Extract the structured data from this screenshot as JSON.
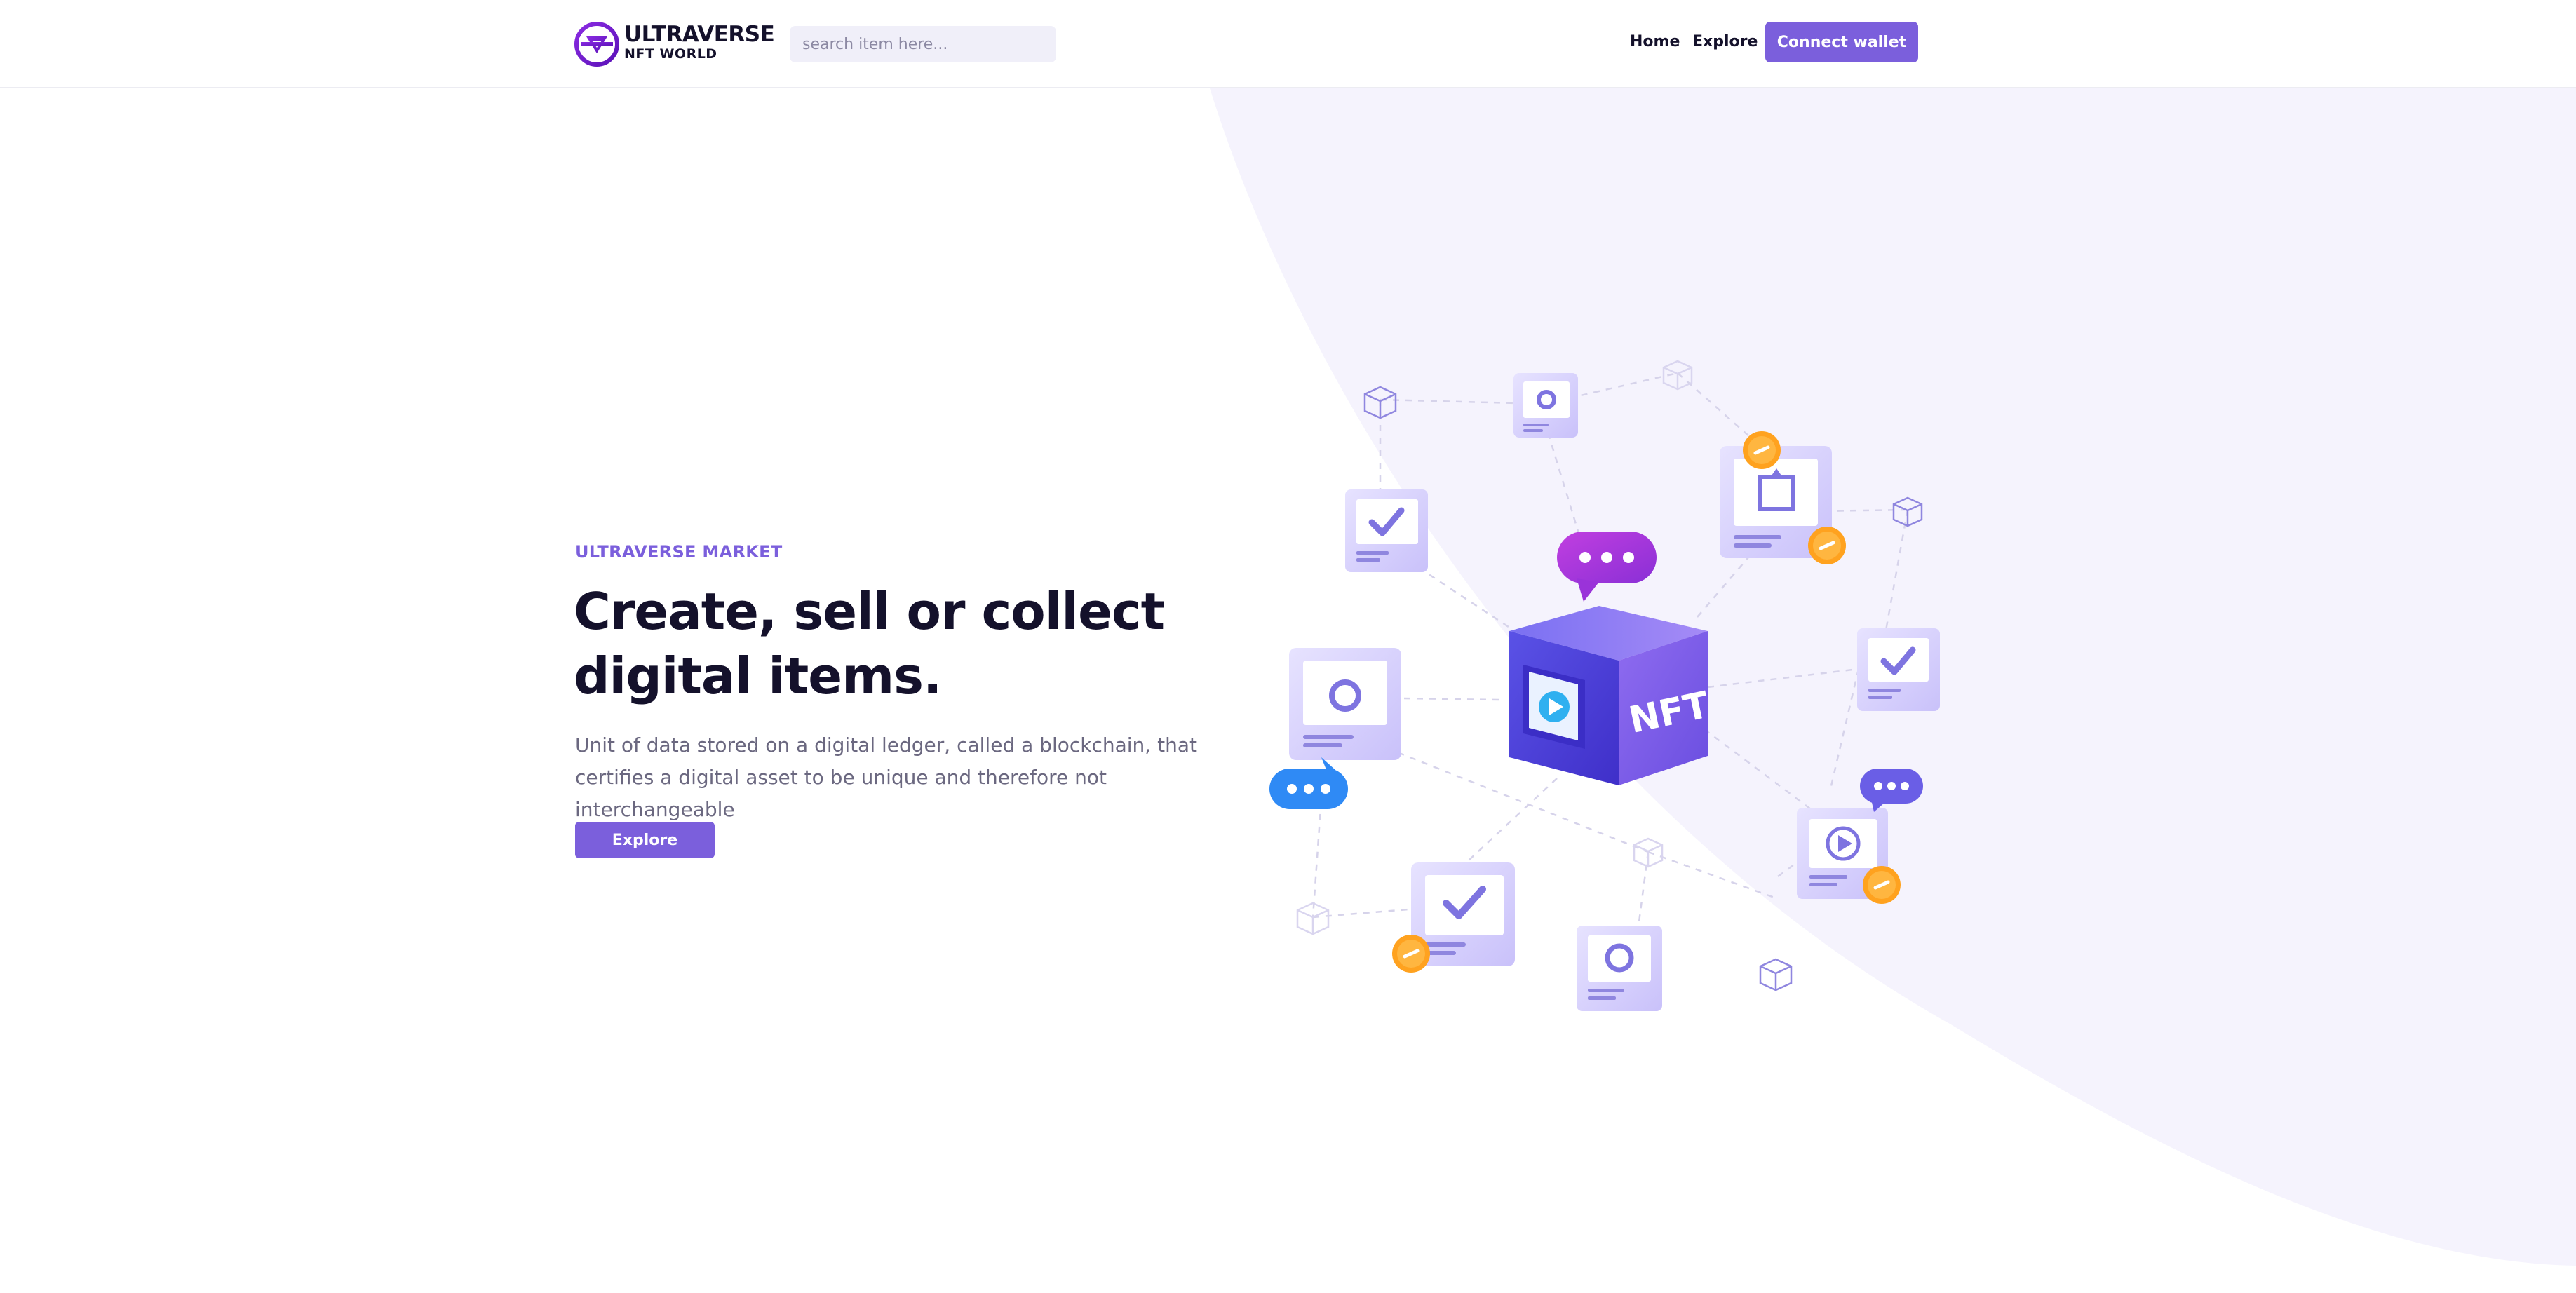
{
  "brand": {
    "name_line1": "ULTRAVERSE",
    "name_line2": "NFT WORLD",
    "logo_icon": "ultraverse-logo-icon"
  },
  "header": {
    "search": {
      "placeholder": "search item here...",
      "value": ""
    },
    "nav": [
      {
        "label": "Home"
      },
      {
        "label": "Explore"
      }
    ],
    "connect_label": "Connect wallet"
  },
  "hero": {
    "eyebrow": "ULTRAVERSE MARKET",
    "headline_line1": "Create, sell or collect",
    "headline_line2": "digital items.",
    "description": "Unit of data stored on a digital ledger, called a blockchain, that certifies a digital asset to be unique and therefore not interchangeable",
    "cta_label": "Explore"
  },
  "illustration": {
    "cube_label": "NFT",
    "icons": [
      "nft-cube-icon",
      "chat-bubble-icon",
      "nft-card-icon",
      "checkmark-icon",
      "play-icon",
      "chain-link-icon",
      "box-outline-icon"
    ]
  },
  "colors": {
    "accent": "#7b5fdc",
    "heading": "#14112b",
    "body_text": "#6b6880",
    "hero_bg": "#f5f3fd",
    "search_bg": "#f0eff9",
    "coin": "#ffa21f",
    "chat_blue": "#2f8af5"
  }
}
